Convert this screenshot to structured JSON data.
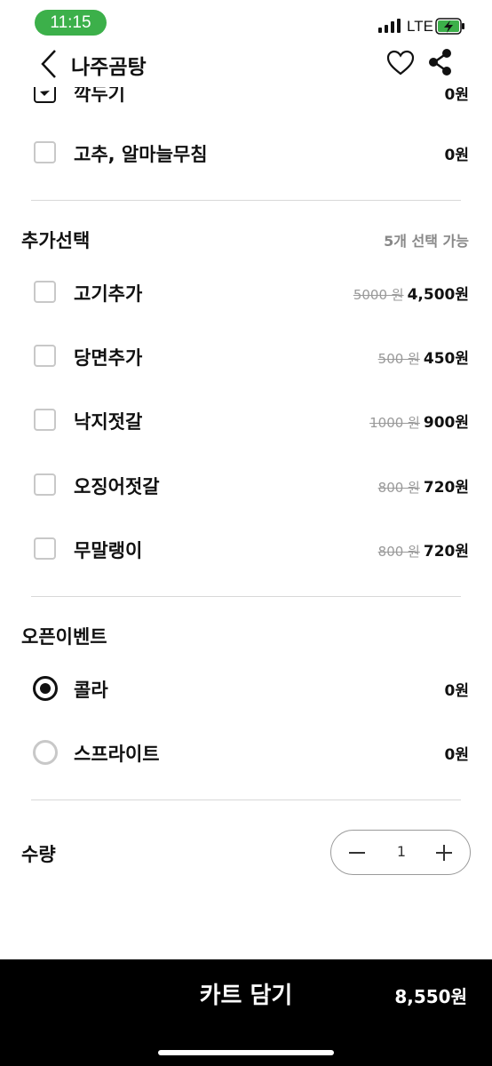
{
  "status_bar": {
    "time": "11:15",
    "network": "LTE"
  },
  "header": {
    "title": "나주곰탕",
    "icons": [
      "back-icon",
      "heart-icon",
      "share-icon"
    ]
  },
  "partial_row": {
    "label": "깍두기",
    "price": "0원"
  },
  "base_options": [
    {
      "label": "고추, 알마늘무침",
      "price": "0원",
      "checked": false
    }
  ],
  "addons": {
    "title": "추가선택",
    "subtitle": "5개 선택 가능",
    "items": [
      {
        "label": "고기추가",
        "original_price": "5000 원",
        "price": "4,500원",
        "checked": false
      },
      {
        "label": "당면추가",
        "original_price": "500 원",
        "price": "450원",
        "checked": false
      },
      {
        "label": "낙지젓갈",
        "original_price": "1000 원",
        "price": "900원",
        "checked": false
      },
      {
        "label": "오징어젓갈",
        "original_price": "800 원",
        "price": "720원",
        "checked": false
      },
      {
        "label": "무말랭이",
        "original_price": "800 원",
        "price": "720원",
        "checked": false
      }
    ]
  },
  "open_event": {
    "title": "오픈이벤트",
    "items": [
      {
        "label": "콜라",
        "price": "0원",
        "selected": true
      },
      {
        "label": "스프라이트",
        "price": "0원",
        "selected": false
      }
    ]
  },
  "quantity": {
    "label": "수량",
    "value": "1"
  },
  "cart": {
    "label": "카트 담기",
    "total": "8,550원"
  },
  "colors": {
    "accent_green": "#3cb04a",
    "cart_bar": "#000000",
    "muted_text": "#888888"
  }
}
